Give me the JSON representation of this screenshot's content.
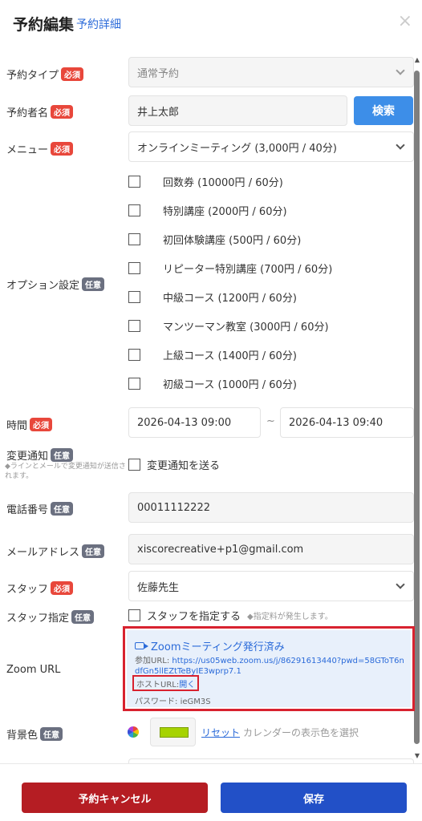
{
  "header": {
    "title": "予約編集",
    "subtitle_link": "予約詳細",
    "close_icon": "×"
  },
  "badges": {
    "required": "必須",
    "optional": "任意"
  },
  "reservation_type": {
    "label": "予約タイプ",
    "value": "通常予約"
  },
  "reserver": {
    "label": "予約者名",
    "value": "井上太郎",
    "search_button": "検索"
  },
  "menu": {
    "label": "メニュー",
    "value": "オンラインミーティング (3,000円 / 40分)"
  },
  "options": {
    "label": "オプション設定",
    "items": [
      "回数券 (10000円 / 60分)",
      "特別講座 (2000円 / 60分)",
      "初回体験講座 (500円 / 60分)",
      "リピーター特別講座 (700円 / 60分)",
      "中級コース (1200円 / 60分)",
      "マンツーマン教室 (3000円 / 60分)",
      "上級コース (1400円 / 60分)",
      "初級コース (1000円 / 60分)"
    ]
  },
  "time": {
    "label": "時間",
    "start": "2026-04-13 09:00",
    "separator": "~",
    "end": "2026-04-13 09:40"
  },
  "change_notice": {
    "label": "変更通知",
    "note": "◆ラインとメールで変更通知が送信されます。",
    "checkbox_label": "変更通知を送る"
  },
  "phone": {
    "label": "電話番号",
    "value": "00011112222"
  },
  "email": {
    "label": "メールアドレス",
    "value": "xiscorecreative+p1@gmail.com"
  },
  "staff": {
    "label": "スタッフ",
    "value": "佐藤先生"
  },
  "staff_assign": {
    "label": "スタッフ指定",
    "checkbox_label": "スタッフを指定する",
    "note": "◆指定料が発生します。"
  },
  "zoom": {
    "label": "Zoom URL",
    "status": "Zoomミーティング発行済み",
    "join_label": "参加URL: ",
    "join_url_line1": "https://us05web.zoom.us/j/86291613440?pwd=58GToT6n",
    "join_url_line2": "dfGn5llEZtTeByIE3wprp7.1",
    "host_label": "ホストURL: ",
    "host_link": "開く",
    "password_label": "パスワード: ",
    "password": "ieGM3S"
  },
  "background_color": {
    "label": "背景色",
    "color": "#a6d300",
    "reset_link": "リセット",
    "note": "カレンダーの表示色を選択"
  },
  "footer": {
    "cancel_button": "予約キャンセル",
    "save_button": "保存"
  },
  "colors": {
    "accent_blue": "#2a6ad9",
    "search_blue": "#3d8ee8",
    "save_blue": "#2250c7",
    "cancel_red": "#b51d23",
    "required_badge": "#e8473b",
    "highlight_red": "#d8222f"
  }
}
